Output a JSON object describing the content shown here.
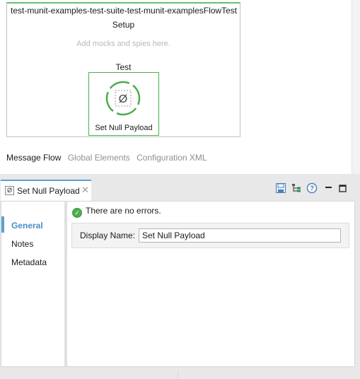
{
  "canvas": {
    "flow_title": "test-munit-examples-test-suite-test-munit-examplesFlowTest",
    "setup_label": "Setup",
    "mocks_hint": "Add mocks and spies here.",
    "test_label": "Test",
    "processor": {
      "label": "Set Null Payload",
      "glyph": "Ø",
      "icon": "set-null-payload-icon"
    }
  },
  "editor_tabs": [
    {
      "label": "Message Flow",
      "active": true
    },
    {
      "label": "Global Elements",
      "active": false
    },
    {
      "label": "Configuration XML",
      "active": false
    }
  ],
  "properties_view": {
    "tab": {
      "label": "Set Null Payload",
      "glyph": "Ø",
      "close": "✕"
    },
    "actions": [
      "save-icon",
      "tree-icon",
      "help-icon",
      "minimize-icon",
      "maximize-icon"
    ],
    "nav": [
      {
        "label": "General",
        "active": true
      },
      {
        "label": "Notes",
        "active": false
      },
      {
        "label": "Metadata",
        "active": false
      }
    ],
    "status": {
      "icon": "check-circle-icon",
      "text": "There are no errors.",
      "check": "✓"
    },
    "form": {
      "display_name_label": "Display Name:",
      "display_name_value": "Set Null Payload"
    }
  },
  "colors": {
    "accent_blue": "#58a3d6",
    "success_green": "#4cae4c"
  }
}
